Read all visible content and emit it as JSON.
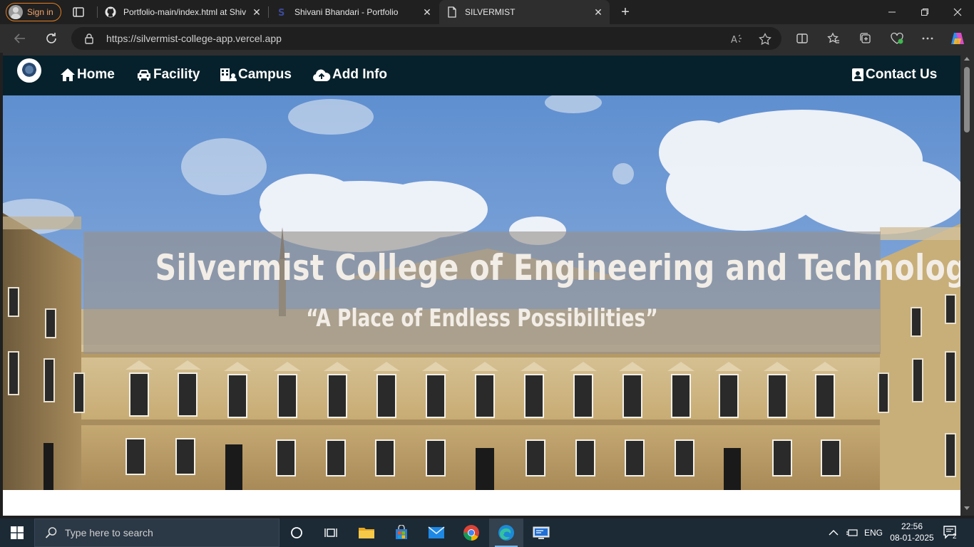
{
  "browser": {
    "signin_label": "Sign in",
    "tabs": [
      {
        "title": "Portfolio-main/index.html at Shiv",
        "icon": "github-icon"
      },
      {
        "title": "Shivani Bhandari - Portfolio",
        "icon": "portfolio-icon"
      },
      {
        "title": "SILVERMIST",
        "icon": "page-icon",
        "active": true
      }
    ],
    "url_scheme": "https://",
    "url_host": "silvermist-college-app.vercel.app"
  },
  "site": {
    "nav": {
      "home": "Home",
      "facility": "Facility",
      "campus": "Campus",
      "add_info": "Add Info",
      "contact": "Contact Us"
    },
    "hero": {
      "title": "Silvermist College of Engineering and Technology",
      "tagline": "“A Place of Endless Possibilities”"
    },
    "colors": {
      "nav_bg": "#06212b",
      "banner_overlay": "rgba(150,145,140,0.62)"
    }
  },
  "taskbar": {
    "search_placeholder": "Type here to search",
    "language": "ENG",
    "time": "22:56",
    "date": "08-01-2025",
    "notification_count": "2"
  }
}
